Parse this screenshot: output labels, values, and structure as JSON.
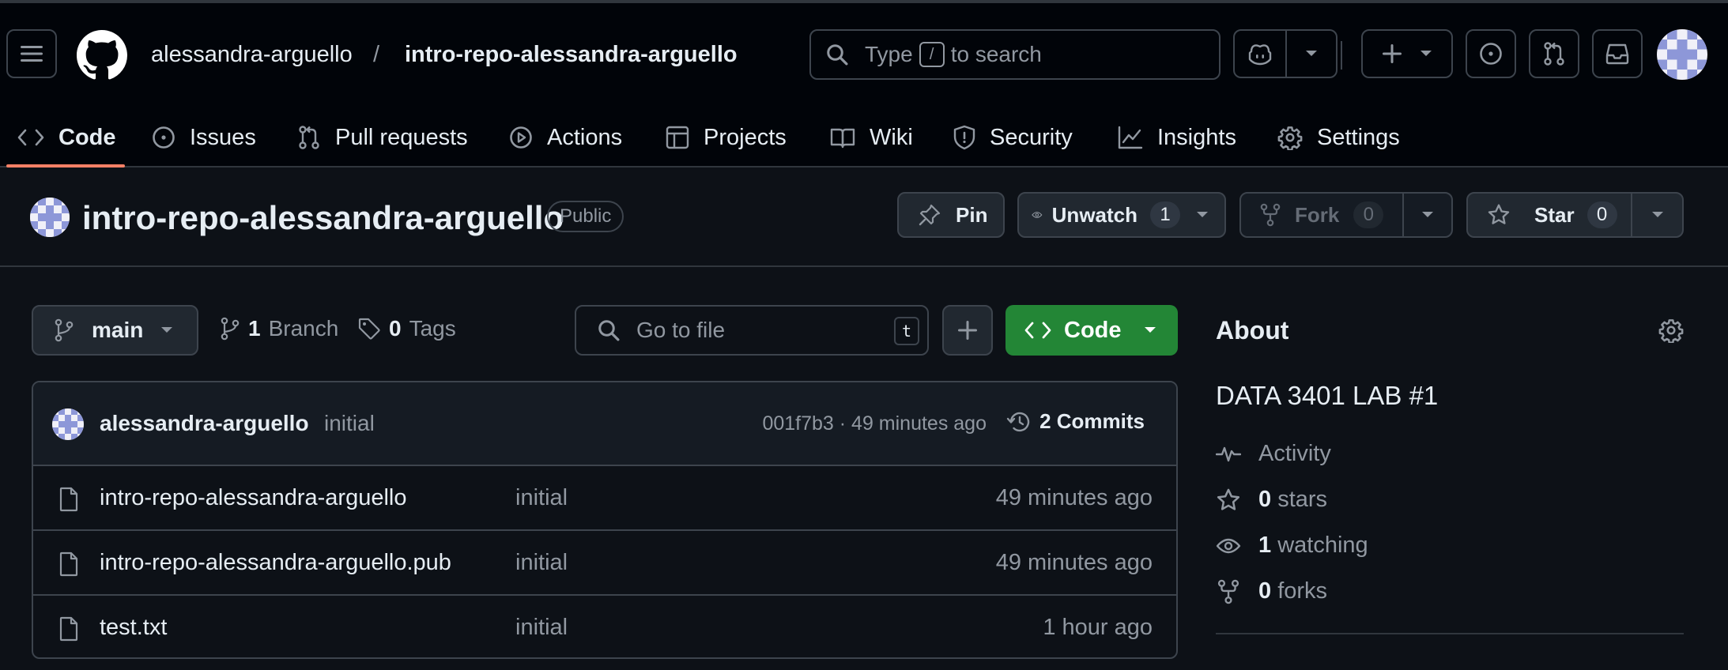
{
  "nav": {
    "owner": "alessandra-arguello",
    "separator": "/",
    "repo": "intro-repo-alessandra-arguello",
    "search_prefix": "Type",
    "search_key": "/",
    "search_suffix": "to search"
  },
  "tabs": [
    {
      "label": "Code",
      "icon": "code-icon",
      "active": true
    },
    {
      "label": "Issues",
      "icon": "issue-icon"
    },
    {
      "label": "Pull requests",
      "icon": "pull-request-icon"
    },
    {
      "label": "Actions",
      "icon": "play-icon"
    },
    {
      "label": "Projects",
      "icon": "table-icon"
    },
    {
      "label": "Wiki",
      "icon": "book-icon"
    },
    {
      "label": "Security",
      "icon": "shield-icon"
    },
    {
      "label": "Insights",
      "icon": "graph-icon"
    },
    {
      "label": "Settings",
      "icon": "gear-icon"
    }
  ],
  "repo": {
    "name": "intro-repo-alessandra-arguello",
    "visibility": "Public",
    "pin_label": "Pin",
    "watch_label": "Unwatch",
    "watch_count": "1",
    "fork_label": "Fork",
    "fork_count": "0",
    "star_label": "Star",
    "star_count": "0"
  },
  "toolbar": {
    "branch": "main",
    "branch_count": "1",
    "branch_label": "Branch",
    "tag_count": "0",
    "tag_label": "Tags",
    "gofile_placeholder": "Go to file",
    "gofile_key": "t",
    "code_label": "Code"
  },
  "commit": {
    "author": "alessandra-arguello",
    "message": "initial",
    "meta": "001f7b3 · 49 minutes ago",
    "count_label": "2 Commits"
  },
  "files": [
    {
      "name": "intro-repo-alessandra-arguello",
      "message": "initial",
      "time": "49 minutes ago"
    },
    {
      "name": "intro-repo-alessandra-arguello.pub",
      "message": "initial",
      "time": "49 minutes ago"
    },
    {
      "name": "test.txt",
      "message": "initial",
      "time": "1 hour ago"
    }
  ],
  "about": {
    "title": "About",
    "description": "DATA 3401 LAB #1",
    "activity": "Activity",
    "stars_count": "0",
    "stars_label": "stars",
    "watching_count": "1",
    "watching_label": "watching",
    "forks_count": "0",
    "forks_label": "forks"
  },
  "colors": {
    "background": "#0d1117",
    "header": "#010409",
    "accent_underline": "#f78166",
    "code_button": "#238636",
    "border": "#3d444d",
    "muted_text": "#9198a1"
  }
}
